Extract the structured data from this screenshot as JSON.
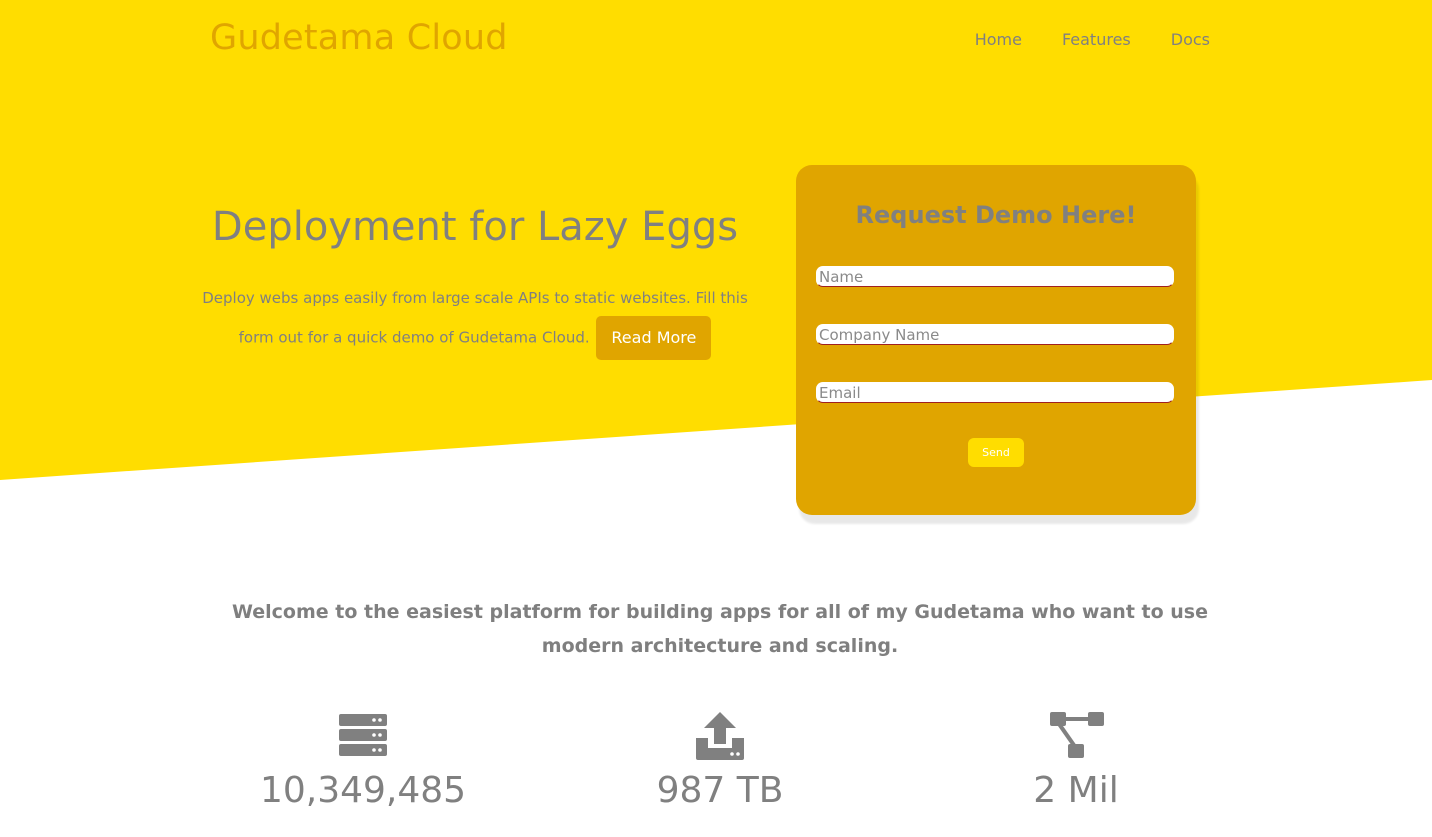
{
  "header": {
    "brand": "Gudetama Cloud",
    "nav": [
      "Home",
      "Features",
      "Docs"
    ]
  },
  "hero": {
    "title": "Deployment for Lazy Eggs",
    "description": "Deploy webs apps easily from large scale APIs to static websites. Fill this form out for a quick demo of Gudetama Cloud.",
    "read_more_label": "Read More"
  },
  "demo_form": {
    "title": "Request Demo Here!",
    "name_placeholder": "Name",
    "company_placeholder": "Company Name",
    "email_placeholder": "Email",
    "send_label": "Send"
  },
  "welcome": {
    "text": "Welcome to the easiest platform for building apps for all of my Gudetama who want to use modern architecture and scaling."
  },
  "stats": [
    {
      "icon": "server-icon",
      "value": "10,349,485"
    },
    {
      "icon": "upload-icon",
      "value": "987 TB"
    },
    {
      "icon": "network-icon",
      "value": "2 Mil"
    }
  ],
  "colors": {
    "hero_yellow": "#ffdd00",
    "accent_gold": "#e0a500",
    "text_gray": "#808080"
  }
}
